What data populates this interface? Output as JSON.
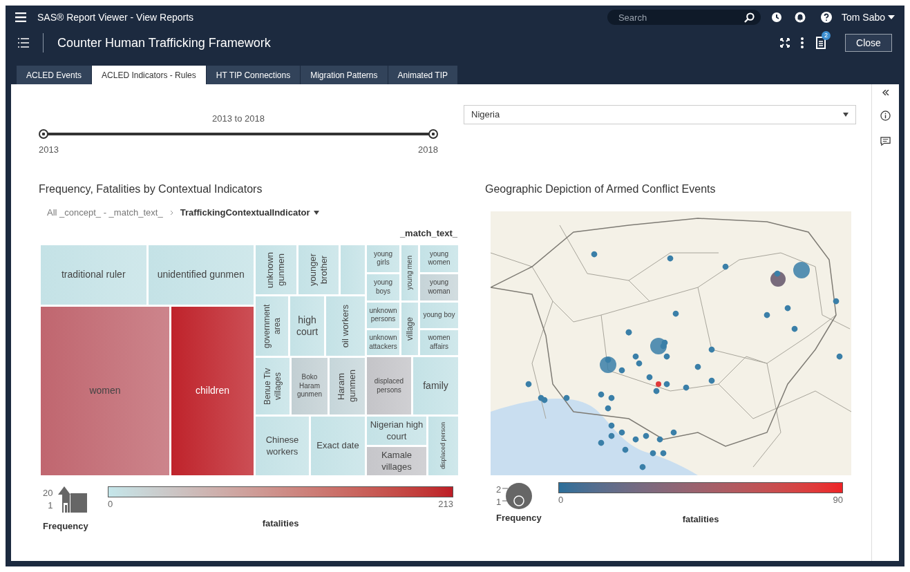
{
  "app_bar": {
    "title": "SAS® Report Viewer - View Reports",
    "search": {
      "placeholder": "Search"
    },
    "user": "Tom Sabo"
  },
  "report_bar": {
    "title": "Counter Human Trafficking Framework",
    "notification_count": "2",
    "close_button": "Close"
  },
  "tabs": [
    {
      "label": "ACLED Events",
      "selected": false
    },
    {
      "label": "ACLED Indicators - Rules",
      "selected": true
    },
    {
      "label": "HT TIP Connections",
      "selected": false
    },
    {
      "label": "Migration Patterns",
      "selected": false
    },
    {
      "label": "Animated TIP",
      "selected": false
    }
  ],
  "year_slider": {
    "label": "2013 to 2018",
    "min_label": "2013",
    "max_label": "2018",
    "low": {
      "level": 0
    },
    "high": {
      "level": 1
    }
  },
  "country_dropdown": {
    "value": "Nigeria"
  },
  "treemap": {
    "title": "Frequency, Fatalities by Contextual Indicators",
    "breadcrumb": {
      "parent": "All _concept_ - _match_text_",
      "current": "TraffickingContextualIndicator"
    },
    "legend_title": "_match_text_",
    "cells": [
      {
        "label": "traditional ruler",
        "color": "#c4e2e6",
        "kind": "horizontal"
      },
      {
        "label": "unidentified gunmen",
        "color": "#c4e2e6",
        "kind": "horizontal"
      },
      {
        "label": "women",
        "color": "#c0666f",
        "kind": "horizontal"
      },
      {
        "label": "children",
        "color": "#bf232b",
        "kind": "horizontal"
      },
      {
        "label": "unknown gunmen",
        "color": "#c4e2e6",
        "kind": "vertical"
      },
      {
        "label": "younger brother",
        "color": "#c4e2e6",
        "kind": "vertical"
      },
      {
        "color": "#c4e2e6",
        "kind": "horizontal"
      },
      {
        "label": "government area",
        "color": "#c4e2e6",
        "kind": "vertical"
      },
      {
        "label": "high court",
        "color": "#c4e2e6",
        "kind": "horizontal"
      },
      {
        "label": "oil workers",
        "color": "#c4e2e6",
        "kind": "vertical"
      },
      {
        "label": "Benue Tiv villages",
        "color": "#c4e2e6",
        "kind": "vertical"
      },
      {
        "label": "Boko Haram gunmen",
        "color": "#c2cfd3",
        "kind": "horizontal"
      },
      {
        "label": "Haram gunmen",
        "color": "#c6d6da",
        "kind": "vertical"
      },
      {
        "label": "Chinese workers",
        "color": "#c4e2e6",
        "kind": "horizontal"
      },
      {
        "label": "Exact date",
        "color": "#c4e2e6",
        "kind": "horizontal"
      },
      {
        "label": "young girls",
        "color": "#c4e2e6",
        "kind": "horizontal"
      },
      {
        "label": "young boys",
        "color": "#c4e2e6",
        "kind": "horizontal"
      },
      {
        "label": "young men",
        "color": "#c4e2e6",
        "kind": "vertical"
      },
      {
        "label": "young women",
        "color": "#c4e2e6",
        "kind": "horizontal"
      },
      {
        "label": "young woman",
        "color": "#c6d4d8",
        "kind": "horizontal"
      },
      {
        "label": "unknown persons",
        "color": "#c4e2e6",
        "kind": "horizontal"
      },
      {
        "label": "unknown attackers",
        "color": "#c4e2e6",
        "kind": "horizontal"
      },
      {
        "label": "village",
        "color": "#c4e2e6",
        "kind": "vertical"
      },
      {
        "label": "young boy",
        "color": "#c4e2e6",
        "kind": "horizontal"
      },
      {
        "label": "women affairs",
        "color": "#c4e2e6",
        "kind": "horizontal"
      },
      {
        "label": "displaced persons",
        "color": "#c4c4c8",
        "kind": "horizontal"
      },
      {
        "label": "family",
        "color": "#c4e2e6",
        "kind": "horizontal"
      },
      {
        "label": "Nigerian high court",
        "color": "#c4e2e6",
        "kind": "horizontal"
      },
      {
        "label": "Kamale villages",
        "color": "#c6c6ca",
        "kind": "horizontal"
      },
      {
        "label": "displaced person",
        "color": "#c4e2e6",
        "kind": "vertical"
      }
    ],
    "size_legend": {
      "max": "20",
      "min": "1",
      "title": "Frequency"
    },
    "color_legend": {
      "min": "0",
      "max": "213",
      "title": "fatalities"
    }
  },
  "map": {
    "title": "Geographic Depiction of Armed Conflict Events",
    "size_legend": {
      "max": "2",
      "min": "1",
      "title": "Frequency"
    },
    "color_legend": {
      "min": "0",
      "max": "90",
      "title": "fatalities"
    }
  }
}
